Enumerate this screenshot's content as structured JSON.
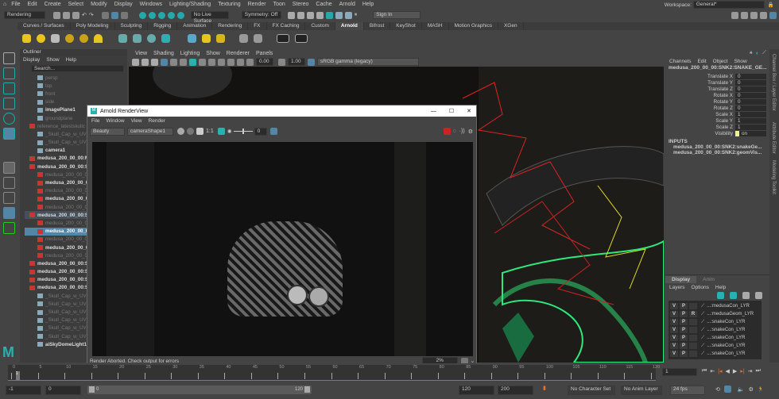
{
  "menus": [
    "File",
    "Edit",
    "Create",
    "Select",
    "Modify",
    "Display",
    "Windows",
    "Lighting/Shading",
    "Texturing",
    "Render",
    "Toon",
    "Stereo",
    "Cache",
    "Arnold",
    "Help"
  ],
  "workspace": {
    "label": "Workspace:",
    "value": "General*"
  },
  "status_line": {
    "mode": "Rendering",
    "live_surface": "No Live Surface",
    "symmetry": "Symmetry: Off",
    "sign_in": "Sign In"
  },
  "shelf_tabs": [
    "Curves / Surfaces",
    "Poly Modeling",
    "Sculpting",
    "Rigging",
    "Animation",
    "Rendering",
    "FX",
    "FX Caching",
    "Custom",
    "Arnold",
    "Bifrost",
    "KeyShot",
    "MASH",
    "Motion Graphics",
    "XGen"
  ],
  "shelf_active": "Arnold",
  "outliner": {
    "title": "Outliner",
    "menus": [
      "Display",
      "Show",
      "Help"
    ],
    "search_placeholder": "Search...",
    "items": [
      {
        "label": "persp",
        "dim": true,
        "indent": 1
      },
      {
        "label": "top",
        "dim": true,
        "indent": 1
      },
      {
        "label": "front",
        "dim": true,
        "indent": 1
      },
      {
        "label": "side",
        "dim": true,
        "indent": 1
      },
      {
        "label": "imagePlane1",
        "dim": false,
        "indent": 1
      },
      {
        "label": "groundplane",
        "dim": true,
        "indent": 1
      },
      {
        "label": "reference_latestskullc",
        "dim": true,
        "indent": 0
      },
      {
        "label": "_Skull_Cap_w_UV_0",
        "dim": true,
        "indent": 1
      },
      {
        "label": "_Skull_Cap_w_UV_0",
        "dim": true,
        "indent": 1
      },
      {
        "label": "camera1",
        "dim": false,
        "indent": 1
      },
      {
        "label": "medusa_200_00_00:M",
        "dim": false,
        "indent": 0
      },
      {
        "label": "medusa_200_00_00:SN",
        "dim": false,
        "indent": 0
      },
      {
        "label": "medusa_200_00_00",
        "dim": true,
        "indent": 1
      },
      {
        "label": "medusa_200_00_00",
        "dim": false,
        "indent": 1
      },
      {
        "label": "medusa_200_00_00",
        "dim": true,
        "indent": 1
      },
      {
        "label": "medusa_200_00_00",
        "dim": false,
        "indent": 1
      },
      {
        "label": "medusa_200_00_00",
        "dim": true,
        "indent": 1
      },
      {
        "label": "medusa_200_00_00:SN",
        "dim": false,
        "indent": 0,
        "sel": "parent"
      },
      {
        "label": "medusa_200_00_00",
        "dim": true,
        "indent": 1
      },
      {
        "label": "medusa_200_00_00",
        "dim": false,
        "indent": 1,
        "sel": "active"
      },
      {
        "label": "medusa_200_00_00",
        "dim": true,
        "indent": 1
      },
      {
        "label": "medusa_200_00_00",
        "dim": false,
        "indent": 1
      },
      {
        "label": "medusa_200_00_00",
        "dim": true,
        "indent": 1
      },
      {
        "label": "medusa_200_00_00:SN",
        "dim": false,
        "indent": 0
      },
      {
        "label": "medusa_200_00_00:SN",
        "dim": false,
        "indent": 0
      },
      {
        "label": "medusa_200_00_00:SN",
        "dim": false,
        "indent": 0
      },
      {
        "label": "medusa_200_00_00:SN",
        "dim": false,
        "indent": 0
      },
      {
        "label": "_Skull_Cap_w_UV_01_",
        "dim": true,
        "indent": 1
      },
      {
        "label": "_Skull_Cap_w_UV_01_",
        "dim": true,
        "indent": 1
      },
      {
        "label": "_Skull_Cap_w_UV_01_",
        "dim": true,
        "indent": 1
      },
      {
        "label": "_Skull_Cap_w_UV_01_",
        "dim": true,
        "indent": 1
      },
      {
        "label": "_Skull_Cap_w_UV_01_",
        "dim": true,
        "indent": 1
      },
      {
        "label": "_Skull_Cap_w_UV_01_",
        "dim": true,
        "indent": 1
      },
      {
        "label": "aiSkyDomeLight1",
        "dim": false,
        "indent": 1
      }
    ]
  },
  "viewport": {
    "menus": [
      "View",
      "Shading",
      "Lighting",
      "Show",
      "Renderer",
      "Panels"
    ],
    "exposure": "0.00",
    "gamma": "1.00",
    "color_space": "sRGB gamma (legacy)"
  },
  "renderview": {
    "title": "Arnold RenderView",
    "menus": [
      "File",
      "Window",
      "View",
      "Render"
    ],
    "aov": "Beauty",
    "camera": "cameraShape1",
    "ratio": "1:1",
    "exposure": "0",
    "status": "Render Aborted. Check output for errors",
    "zoom": "2%"
  },
  "channelbox": {
    "menus": [
      "Channels",
      "Edit",
      "Object",
      "Show"
    ],
    "object": "medusa_200_00_00:SNK2:SNAKE_GE...",
    "attrs": [
      {
        "name": "Translate X",
        "value": "0"
      },
      {
        "name": "Translate Y",
        "value": "0"
      },
      {
        "name": "Translate Z",
        "value": "0"
      },
      {
        "name": "Rotate X",
        "value": "0"
      },
      {
        "name": "Rotate Y",
        "value": "0"
      },
      {
        "name": "Rotate Z",
        "value": "0"
      },
      {
        "name": "Scale X",
        "value": "1"
      },
      {
        "name": "Scale Y",
        "value": "1"
      },
      {
        "name": "Scale Z",
        "value": "1"
      },
      {
        "name": "Visibility",
        "value": "on"
      }
    ],
    "inputs_label": "INPUTS",
    "inputs": [
      "medusa_200_00_00:SNK2:snakeGe...",
      "medusa_200_00_00:SNK2:geomVis..."
    ]
  },
  "layers": {
    "tabs": [
      "Display",
      "Anim"
    ],
    "menus": [
      "Layers",
      "Options",
      "Help"
    ],
    "rows": [
      {
        "v": "V",
        "p": "P",
        "r": "",
        "name": "...:medusaCon_LYR"
      },
      {
        "v": "V",
        "p": "P",
        "r": "R",
        "name": "...:medusaGeom_LYR"
      },
      {
        "v": "V",
        "p": "P",
        "r": "",
        "name": "...:snakeCon_LYR"
      },
      {
        "v": "V",
        "p": "P",
        "r": "",
        "name": "...:snakeCon_LYR"
      },
      {
        "v": "V",
        "p": "P",
        "r": "",
        "name": "...:snakeCon_LYR"
      },
      {
        "v": "V",
        "p": "P",
        "r": "",
        "name": "...:snakeCon_LYR"
      },
      {
        "v": "V",
        "p": "P",
        "r": "",
        "name": "...:snakeCon_LYR"
      }
    ]
  },
  "side_tabs": [
    "Channel Box / Layer Editor",
    "Attribute Editor",
    "Modeling Toolkit"
  ],
  "timeline": {
    "ticks": [
      "0",
      "5",
      "10",
      "15",
      "20",
      "25",
      "30",
      "35",
      "40",
      "45",
      "50",
      "55",
      "60",
      "65",
      "70",
      "75",
      "80",
      "85",
      "90",
      "95",
      "100",
      "105",
      "110",
      "115",
      "120"
    ],
    "current_frame": "1",
    "current_field": "1",
    "max": 120
  },
  "range": {
    "start": "-1",
    "anim_start": "0",
    "range_start": "0",
    "range_end": "120",
    "end": "120",
    "anim_end": "200",
    "character_set": "No Character Set",
    "anim_layer": "No Anim Layer",
    "fps": "24 fps"
  },
  "colors": {
    "accent": "#5285a6",
    "shelf_icon": "#e8c51c",
    "teal": "#2ab0b0",
    "green_wire": "#2de87a"
  }
}
